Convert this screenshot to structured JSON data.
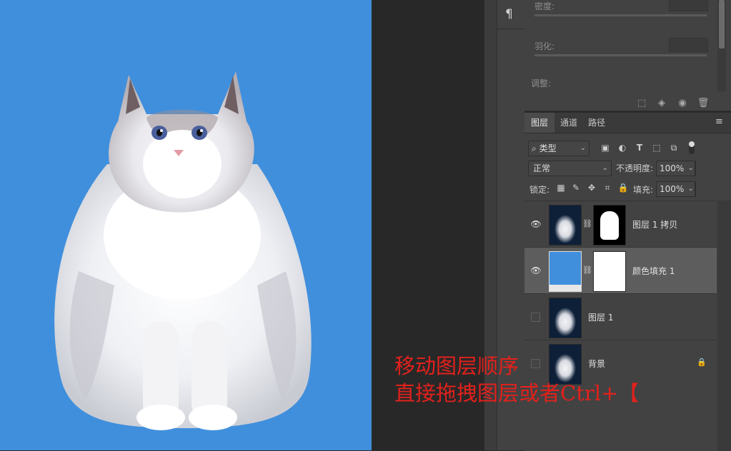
{
  "colors": {
    "canvas_bg": "#408fdc",
    "annotation": "#e3211c",
    "panel_bg": "#424242",
    "selected_row": "#5d5d5d"
  },
  "tool_strip": {
    "paragraph_icon": "¶"
  },
  "properties": {
    "density_label": "密度:",
    "feather_label": "羽化:",
    "adjust_label": "调整:",
    "buttons": [
      "selection-icon",
      "apply-mask-icon",
      "eye-icon",
      "trash-icon"
    ]
  },
  "layers_panel": {
    "tabs": [
      "图层",
      "通道",
      "路径"
    ],
    "active_tab": "图层",
    "filter_kind": "类型",
    "blend_mode": "正常",
    "opacity_label": "不透明度:",
    "opacity_value": "100%",
    "lock_label": "锁定:",
    "fill_label": "填充:",
    "fill_value": "100%",
    "layers": [
      {
        "name": "图层 1 拷贝",
        "visible": true,
        "selected": false
      },
      {
        "name": "颜色填充 1",
        "visible": true,
        "selected": true
      },
      {
        "name": "图层 1",
        "visible": false,
        "selected": false
      },
      {
        "name": "背景",
        "visible": false,
        "selected": false,
        "locked": true
      }
    ]
  },
  "annotation": {
    "line1": "移动图层顺序",
    "line2": "直接拖拽图层或者Ctrl+【"
  }
}
